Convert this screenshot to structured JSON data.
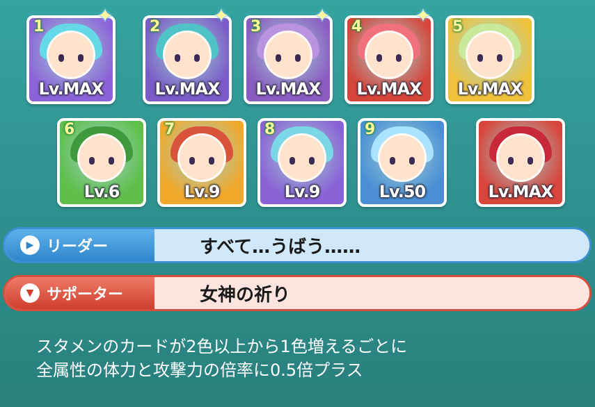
{
  "cards": [
    {
      "number": "1",
      "level": "Lv.MAX",
      "bg": "#8b63d8",
      "hair": "#66d9e8",
      "sparkle": true
    },
    {
      "number": "2",
      "level": "Lv.MAX",
      "bg": "#7a5bc7",
      "hair": "#4fc3c8",
      "sparkle": true
    },
    {
      "number": "3",
      "level": "Lv.MAX",
      "bg": "#8a5cc2",
      "hair": "#b992e0",
      "sparkle": true
    },
    {
      "number": "4",
      "level": "Lv.MAX",
      "bg": "#d6453a",
      "hair": "#f0707b",
      "sparkle": true
    },
    {
      "number": "5",
      "level": "Lv.MAX",
      "bg": "#f0c23c",
      "hair": "#c8e89a",
      "sparkle": false
    },
    {
      "number": "6",
      "level": "Lv.6",
      "bg": "#5fbf4a",
      "hair": "#3e9a3c",
      "sparkle": false
    },
    {
      "number": "7",
      "level": "Lv.9",
      "bg": "#f0a82a",
      "hair": "#d8533a",
      "sparkle": false
    },
    {
      "number": "8",
      "level": "Lv.9",
      "bg": "#8a62d6",
      "hair": "#7ad8e6",
      "sparkle": false
    },
    {
      "number": "9",
      "level": "Lv.50",
      "bg": "#4a8fd6",
      "hair": "#a9e3ff",
      "sparkle": false
    },
    {
      "number": "",
      "level": "Lv.MAX",
      "bg": "#d8453b",
      "hair": "#c8283a",
      "sparkle": false
    }
  ],
  "leader": {
    "label": "リーダー",
    "skill": "すべて…うばう……"
  },
  "support": {
    "label": "サポーター",
    "skill": "女神の祈り"
  },
  "description": {
    "line1": "スタメンのカードが2色以上から1色増えるごとに",
    "line2": "全属性の体力と攻撃力の倍率に0.5倍プラス"
  }
}
